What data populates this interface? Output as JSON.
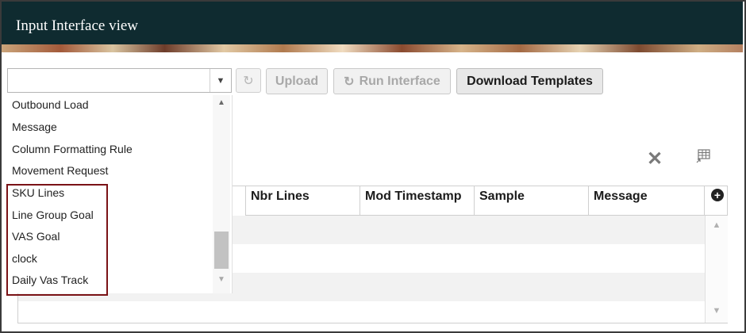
{
  "header": {
    "title": "Input Interface view"
  },
  "toolbar": {
    "combo_value": "",
    "upload_label": "Upload",
    "run_interface_label": "Run Interface",
    "download_templates_label": "Download Templates"
  },
  "dropdown": {
    "items": [
      {
        "label": "Outbound Load"
      },
      {
        "label": "Message"
      },
      {
        "label": "Column Formatting Rule"
      },
      {
        "label": "Movement Request"
      },
      {
        "label": "SKU Lines"
      },
      {
        "label": "Line Group Goal"
      },
      {
        "label": "VAS Goal"
      },
      {
        "label": "clock"
      },
      {
        "label": "Daily Vas Track"
      }
    ]
  },
  "grid": {
    "columns": [
      {
        "label": "Nbr Lines"
      },
      {
        "label": "Mod Timestamp"
      },
      {
        "label": "Sample"
      },
      {
        "label": "Message"
      }
    ]
  },
  "icons": {
    "refresh": "refresh-icon",
    "close": "close-icon",
    "table_settings": "table-settings-icon",
    "add": "add-icon"
  },
  "colors": {
    "header_bg": "#0f2b30",
    "highlight_border": "#7a1216"
  }
}
